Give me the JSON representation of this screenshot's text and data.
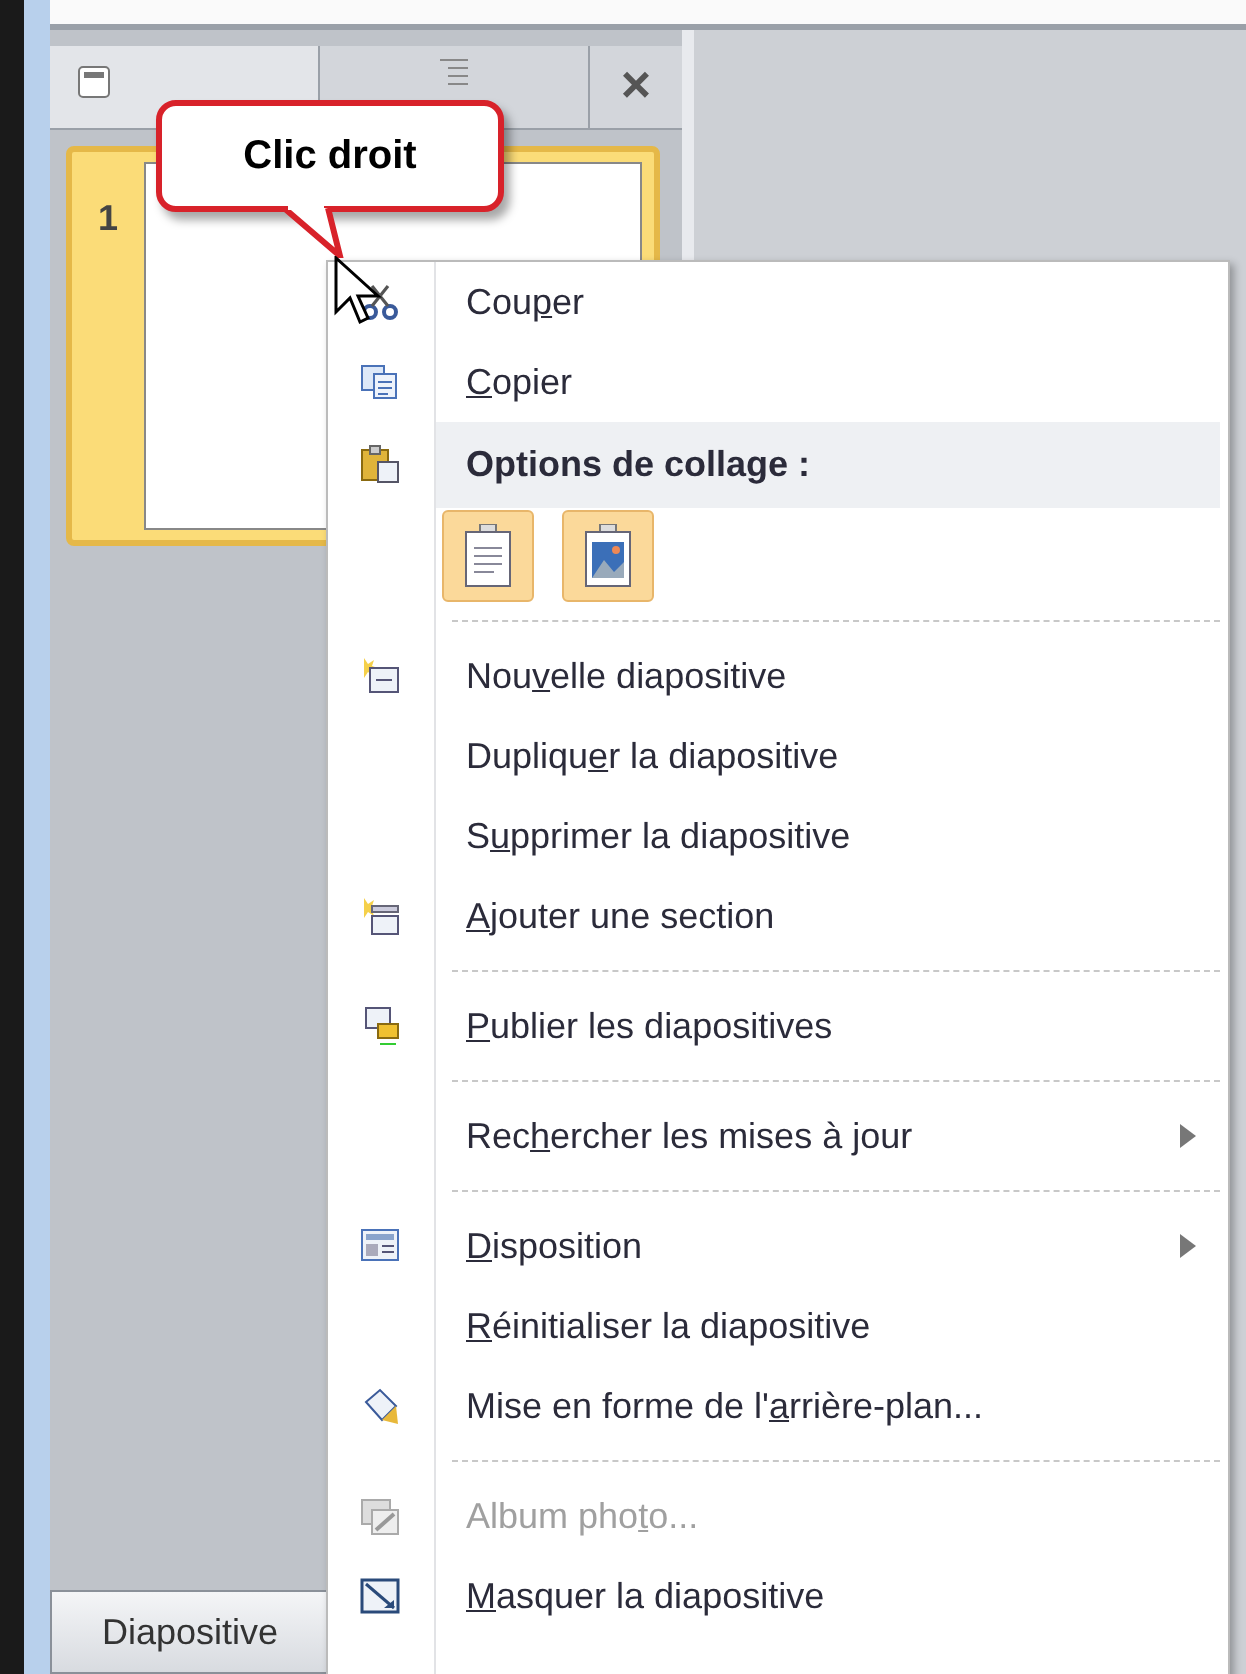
{
  "panel": {
    "close": "×",
    "slide_number": "1",
    "bottom_tab": "Diapositive"
  },
  "callout": "Clic droit",
  "menu": [
    {
      "kind": "item",
      "before": "Cou",
      "key": "p",
      "after": "er",
      "disabled": false,
      "submenu": false
    },
    {
      "kind": "item",
      "key": "C",
      "after": "opier",
      "disabled": false,
      "submenu": false
    },
    {
      "kind": "header",
      "label": "Options de collage :"
    },
    {
      "kind": "paste"
    },
    {
      "kind": "separator"
    },
    {
      "kind": "item",
      "before": "Nou",
      "key": "v",
      "after": "elle diapositive",
      "disabled": false,
      "submenu": false
    },
    {
      "kind": "item",
      "before": "Dupliqu",
      "key": "e",
      "after": "r la diapositive",
      "disabled": false,
      "submenu": false
    },
    {
      "kind": "item",
      "before": "S",
      "key": "u",
      "after": "pprimer la diapositive",
      "disabled": false,
      "submenu": false
    },
    {
      "kind": "item",
      "key": "A",
      "after": "jouter une section",
      "disabled": false,
      "submenu": false
    },
    {
      "kind": "separator"
    },
    {
      "kind": "item",
      "key": "P",
      "after": "ublier les diapositives",
      "disabled": false,
      "submenu": false
    },
    {
      "kind": "separator"
    },
    {
      "kind": "item",
      "before": "Rec",
      "key": "h",
      "after": "ercher les mises à jour",
      "disabled": false,
      "submenu": true
    },
    {
      "kind": "separator"
    },
    {
      "kind": "item",
      "key": "D",
      "after": "isposition",
      "disabled": false,
      "submenu": true
    },
    {
      "kind": "item",
      "key": "R",
      "after": "éinitialiser la diapositive",
      "disabled": false,
      "submenu": false
    },
    {
      "kind": "item",
      "before": "Mise en forme de l'",
      "key": "a",
      "after": "rrière-plan...",
      "disabled": false,
      "submenu": false
    },
    {
      "kind": "separator"
    },
    {
      "kind": "item",
      "before": "Album pho",
      "key": "t",
      "after": "o...",
      "disabled": true,
      "submenu": false
    },
    {
      "kind": "item",
      "key": "M",
      "after": "asquer la diapositive",
      "disabled": false,
      "submenu": false
    }
  ]
}
